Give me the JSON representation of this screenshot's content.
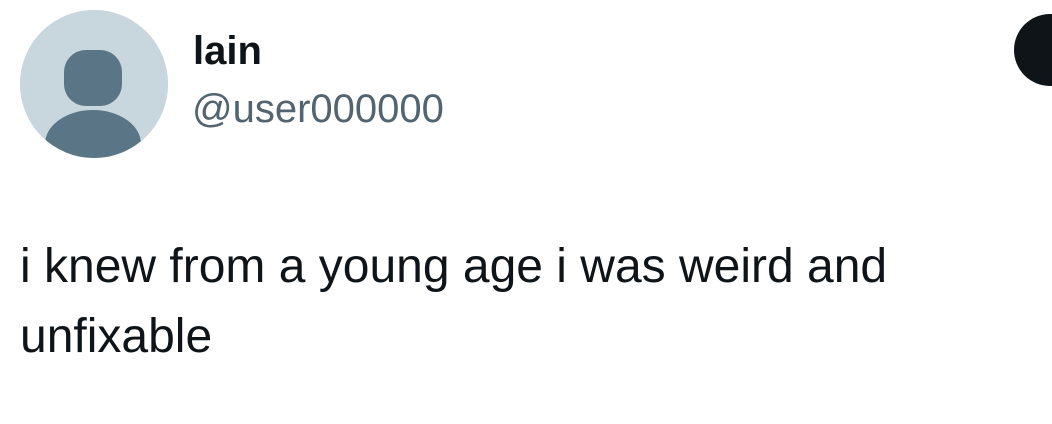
{
  "tweet": {
    "author": {
      "display_name": "lain",
      "handle": "@user000000",
      "avatar_icon": "default-avatar-icon"
    },
    "text": "i knew from a young age i was weird and unfixable"
  },
  "colors": {
    "background": "#ffffff",
    "text": "#0f1419",
    "secondary_text": "#536471",
    "avatar_bg": "#c8d6dd",
    "avatar_figure": "#5a7585",
    "button": "#0f1419"
  }
}
